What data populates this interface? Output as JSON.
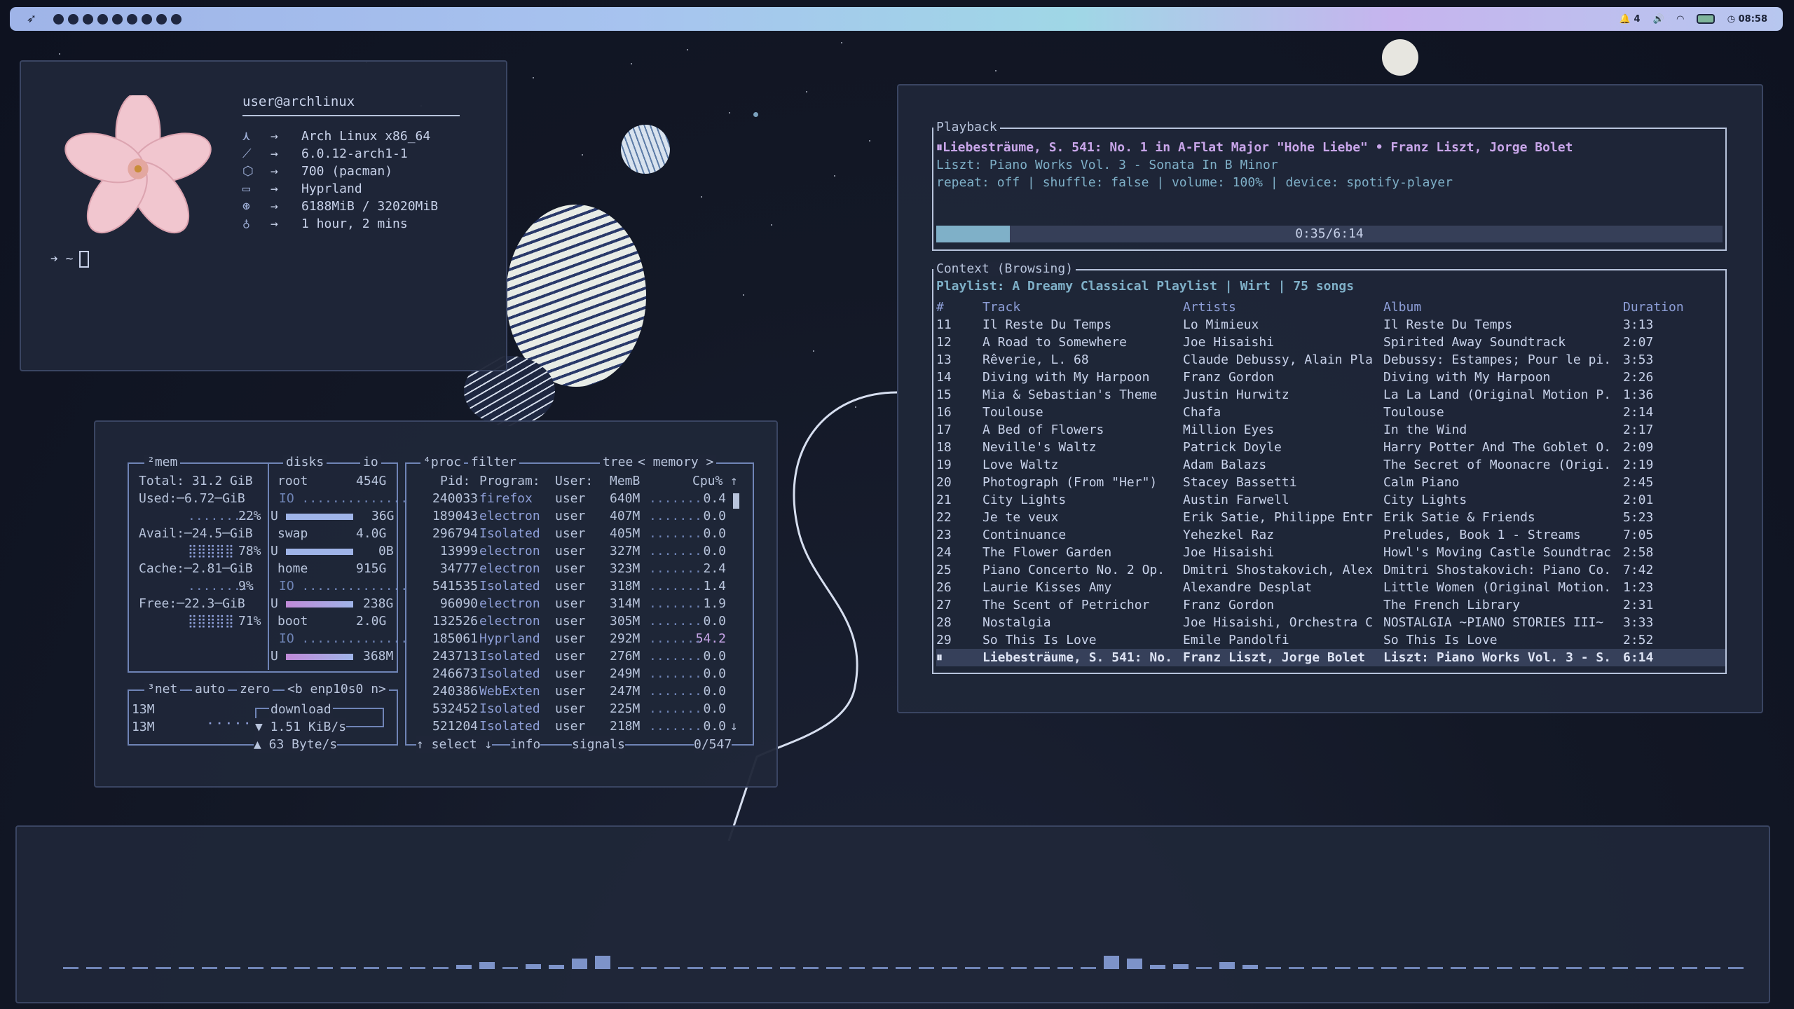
{
  "topbar": {
    "launcher_icon": "rocket-icon",
    "workspaces": 9,
    "notifications": "4",
    "clock": "08:58",
    "accent": "#9fb4e8"
  },
  "fetch": {
    "header": "user@archlinux",
    "rows": [
      {
        "icon": "arch-icon",
        "glyph": "⋏",
        "value": "Arch Linux x86_64"
      },
      {
        "icon": "wrench-icon",
        "glyph": "⟋",
        "value": "6.0.12-arch1-1"
      },
      {
        "icon": "package-icon",
        "glyph": "⬡",
        "value": "700 (pacman)"
      },
      {
        "icon": "monitor-icon",
        "glyph": "▭",
        "value": "Hyprland"
      },
      {
        "icon": "memory-icon",
        "glyph": "⊛",
        "value": "6188MiB / 32020MiB"
      },
      {
        "icon": "bulb-icon",
        "glyph": "♁",
        "value": "1 hour, 2 mins"
      }
    ],
    "arrow": "→",
    "prompt": "➔ ~"
  },
  "btop": {
    "mem": {
      "title": "²mem",
      "total": "Total: 31.2 GiB",
      "used": "Used:─6.72─GiB",
      "used_pct": "22%",
      "avail": "Avail:─24.5─GiB",
      "avail_pct": "78%",
      "cache": "Cache:─2.81─GiB",
      "cache_pct": "9%",
      "free": "Free:─22.3─GiB",
      "free_pct": "71%"
    },
    "disks": {
      "title": "disks",
      "io_label": "io",
      "items": [
        {
          "name": "root",
          "size": "454G",
          "used": "36G",
          "fill": 0.8
        },
        {
          "name": "swap",
          "size": "4.0G",
          "used": "0B",
          "fill": 0.95
        },
        {
          "name": "home",
          "size": "915G",
          "used": "238G",
          "fill": 0.95
        },
        {
          "name": "boot",
          "size": "2.0G",
          "used": "368M",
          "fill": 0.95
        }
      ]
    },
    "net": {
      "title": "³net",
      "auto": "auto",
      "zero": "zero",
      "iface": "<b enp10s0 n>",
      "top_scale": "13M",
      "bottom_scale": "13M",
      "download_label": "download",
      "download": "▼ 1.51 KiB/s",
      "upload": "▲ 63 Byte/s"
    },
    "proc": {
      "title": "⁴proc",
      "filter": "filter",
      "tree": "tree",
      "sort": "< memory >",
      "headers": [
        "Pid:",
        "Program:",
        "User:",
        "MemB",
        "Cpu%"
      ],
      "rows": [
        [
          "240033",
          "firefox",
          "user",
          "640M",
          "0.4"
        ],
        [
          "189043",
          "electron",
          "user",
          "407M",
          "0.0"
        ],
        [
          "296794",
          "Isolated",
          "user",
          "405M",
          "0.0"
        ],
        [
          "13999",
          "electron",
          "user",
          "327M",
          "0.0"
        ],
        [
          "34777",
          "electron",
          "user",
          "323M",
          "2.4"
        ],
        [
          "541535",
          "Isolated",
          "user",
          "318M",
          "1.4"
        ],
        [
          "96090",
          "electron",
          "user",
          "314M",
          "1.9"
        ],
        [
          "132526",
          "electron",
          "user",
          "305M",
          "0.0"
        ],
        [
          "185061",
          "Hyprland",
          "user",
          "292M",
          "54.2"
        ],
        [
          "243713",
          "Isolated",
          "user",
          "276M",
          "0.0"
        ],
        [
          "246673",
          "Isolated",
          "user",
          "249M",
          "0.0"
        ],
        [
          "240386",
          "WebExten",
          "user",
          "247M",
          "0.0"
        ],
        [
          "532452",
          "Isolated",
          "user",
          "225M",
          "0.0"
        ],
        [
          "521204",
          "Isolated",
          "user",
          "218M",
          "0.0"
        ]
      ],
      "footer_select": "↑ select ↓",
      "footer_info": "info",
      "footer_signals": "signals",
      "count": "0/547"
    }
  },
  "spotify": {
    "playback_title": "Playback",
    "now_playing": "⏸Liebesträume, S. 541: No. 1 in A-Flat Major \"Hohe Liebe\" • Franz Liszt, Jorge Bolet",
    "album_line": "Liszt: Piano Works Vol. 3 - Sonata In B Minor",
    "status_line": "repeat: off | shuffle: false | volume: 100% | device: spotify-player",
    "progress_text": "0:35/6:14",
    "progress": 0.094,
    "context_title": "Context (Browsing)",
    "playlist_line": "Playlist: A Dreamy Classical Playlist | Wirt | 75 songs",
    "headers": [
      "#",
      "Track",
      "Artists",
      "Album",
      "Duration"
    ],
    "tracks": [
      [
        "11",
        "Il Reste Du Temps",
        "Lo Mimieux",
        "Il Reste Du Temps",
        "3:13"
      ],
      [
        "12",
        "A Road to Somewhere",
        "Joe Hisaishi",
        "Spirited Away Soundtrack",
        "2:07"
      ],
      [
        "13",
        "Rêverie, L. 68",
        "Claude Debussy, Alain Pla",
        "Debussy: Estampes; Pour le pi.",
        "3:53"
      ],
      [
        "14",
        "Diving with My Harpoon",
        "Franz Gordon",
        "Diving with My Harpoon",
        "2:26"
      ],
      [
        "15",
        "Mia & Sebastian's Theme",
        "Justin Hurwitz",
        "La La Land (Original Motion P.",
        "1:36"
      ],
      [
        "16",
        "Toulouse",
        "Chafa",
        "Toulouse",
        "2:14"
      ],
      [
        "17",
        "A Bed of Flowers",
        "Million Eyes",
        "In the Wind",
        "2:17"
      ],
      [
        "18",
        "Neville's Waltz",
        "Patrick Doyle",
        "Harry Potter And The Goblet O.",
        "2:09"
      ],
      [
        "19",
        "Love Waltz",
        "Adam Balazs",
        "The Secret of Moonacre (Origi.",
        "2:19"
      ],
      [
        "20",
        "Photograph (From \"Her\")",
        "Stacey Bassetti",
        "Calm Piano",
        "2:45"
      ],
      [
        "21",
        "City Lights",
        "Austin Farwell",
        "City Lights",
        "2:01"
      ],
      [
        "22",
        "Je te veux",
        "Erik Satie, Philippe Entr",
        "Erik Satie & Friends",
        "5:23"
      ],
      [
        "23",
        "Continuance",
        "Yehezkel Raz",
        "Preludes, Book 1 - Streams",
        "7:05"
      ],
      [
        "24",
        "The Flower Garden",
        "Joe Hisaishi",
        "Howl's Moving Castle Soundtrac",
        "2:58"
      ],
      [
        "25",
        "Piano Concerto No. 2 Op.",
        "Dmitri Shostakovich, Alex",
        "Dmitri Shostakovich: Piano Co.",
        "7:42"
      ],
      [
        "26",
        "Laurie Kisses Amy",
        "Alexandre Desplat",
        "Little Women (Original Motion.",
        "1:23"
      ],
      [
        "27",
        "The Scent of Petrichor",
        "Franz Gordon",
        "The French Library",
        "2:31"
      ],
      [
        "28",
        "Nostalgia",
        "Joe Hisaishi, Orchestra C",
        "NOSTALGIA ~PIANO STORIES III~",
        "3:33"
      ],
      [
        "29",
        "So This Is Love",
        "Emile Pandolfi",
        "So This Is Love",
        "2:52"
      ],
      [
        "⏸",
        "Liebesträume, S. 541: No.",
        "Franz Liszt, Jorge Bolet",
        "Liszt: Piano Works Vol. 3 - S.",
        "6:14"
      ]
    ]
  },
  "visualizer": {
    "levels": [
      0,
      0,
      0,
      0,
      0,
      0,
      0,
      0,
      0,
      0,
      0,
      0,
      0,
      0,
      0,
      0,
      0,
      0.15,
      0.35,
      0,
      0.25,
      0.2,
      0.5,
      0.65,
      0,
      0,
      0,
      0,
      0,
      0,
      0,
      0,
      0,
      0,
      0,
      0,
      0,
      0,
      0,
      0,
      0,
      0,
      0,
      0,
      0,
      0.65,
      0.5,
      0.2,
      0.25,
      0,
      0.35,
      0.15,
      0,
      0,
      0,
      0,
      0,
      0,
      0,
      0,
      0,
      0,
      0,
      0,
      0,
      0,
      0,
      0,
      0,
      0,
      0,
      0,
      0
    ]
  }
}
